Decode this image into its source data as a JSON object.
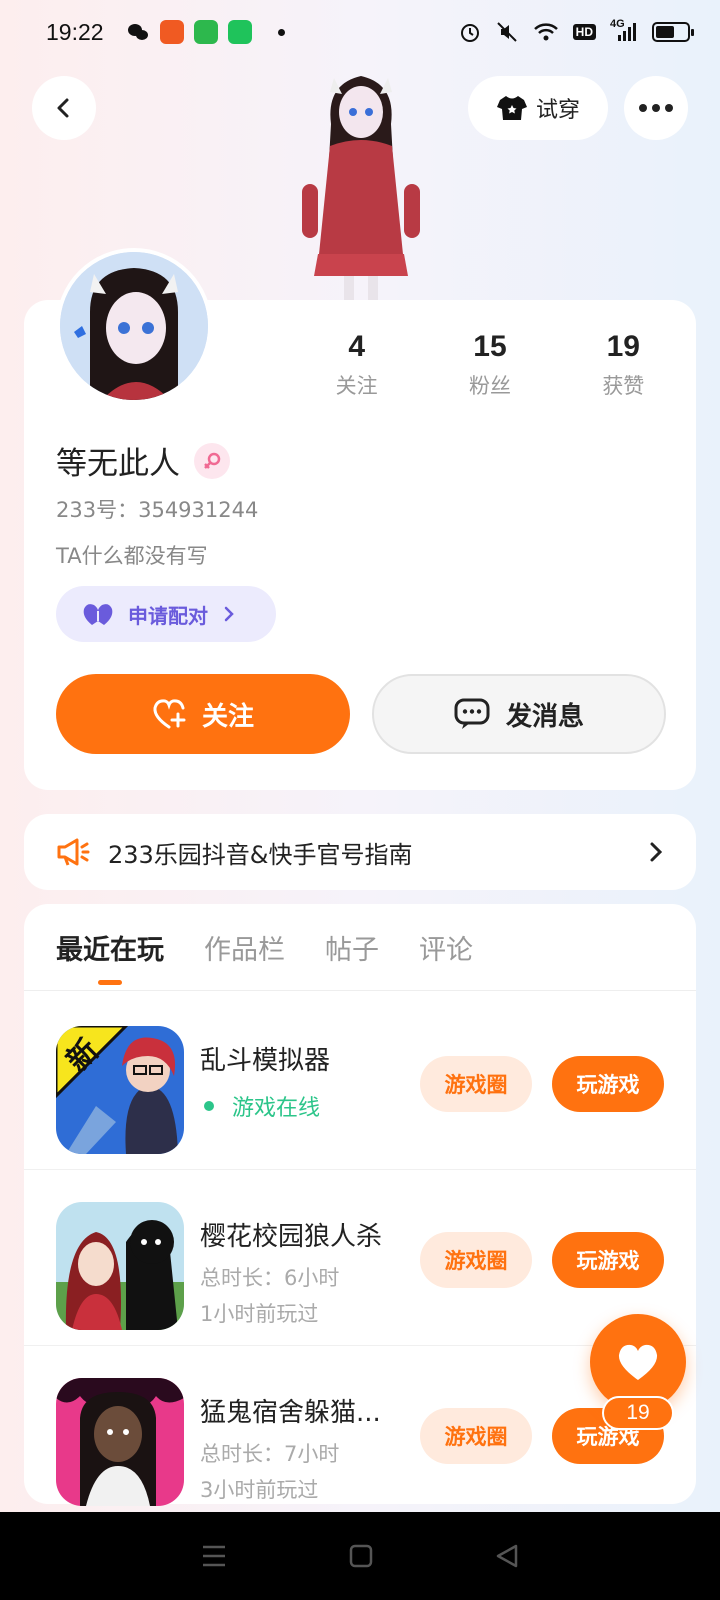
{
  "status_bar": {
    "time": "19:22",
    "network": "4G",
    "hd": "HD",
    "battery_level": 0.6
  },
  "header": {
    "back_icon": "chevron-left-icon",
    "tryon_label": "试穿",
    "more_icon": "more-dots-icon"
  },
  "profile": {
    "stats": [
      {
        "value": "4",
        "label": "关注"
      },
      {
        "value": "15",
        "label": "粉丝"
      },
      {
        "value": "19",
        "label": "获赞"
      }
    ],
    "name": "等无此人",
    "gender_icon": "female-icon",
    "uid_label": "233号：",
    "uid": "354931244",
    "bio": "TA什么都没有写",
    "pair_label": "申请配对",
    "follow_label": "关注",
    "message_label": "发消息"
  },
  "notice": {
    "text": "233乐园抖音&快手官号指南"
  },
  "tabs": [
    {
      "label": "最近在玩",
      "active": true
    },
    {
      "label": "作品栏",
      "active": false
    },
    {
      "label": "帖子",
      "active": false
    },
    {
      "label": "评论",
      "active": false
    }
  ],
  "games": [
    {
      "name": "乱斗模拟器",
      "status": "游戏在线",
      "circle_label": "游戏圈",
      "play_label": "玩游戏",
      "tag": "新"
    },
    {
      "name": "樱花校园狼人杀",
      "duration": "总时长：6小时",
      "last_played": "1小时前玩过",
      "circle_label": "游戏圈",
      "play_label": "玩游戏"
    },
    {
      "name": "猛鬼宿舍躲猫...",
      "duration": "总时长：7小时",
      "last_played": "3小时前玩过",
      "circle_label": "游戏圈",
      "play_label": "玩游戏"
    }
  ],
  "floating": {
    "like_count": "19"
  },
  "colors": {
    "accent": "#ff7210",
    "online": "#2cc58a",
    "pair": "#6a5bdc"
  }
}
